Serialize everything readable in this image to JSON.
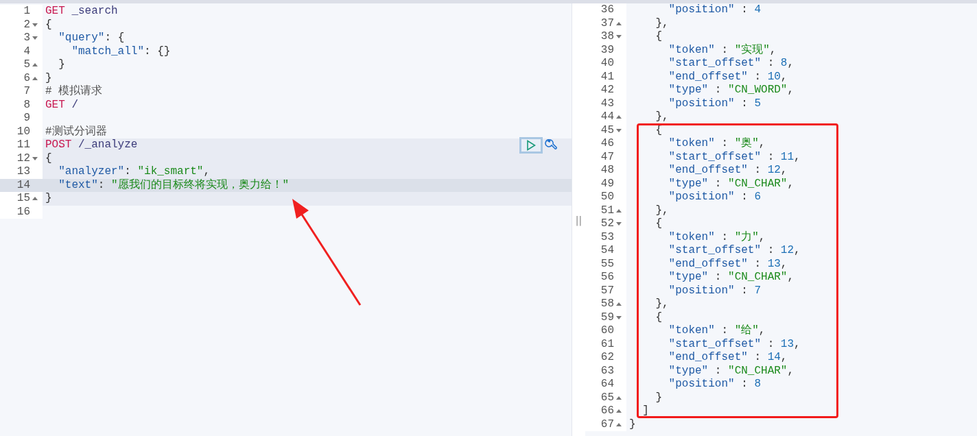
{
  "request_editor": {
    "lines": [
      {
        "number": "1",
        "in_request": false,
        "current": false,
        "tokens": [
          {
            "kind": "method",
            "text": "GET"
          },
          {
            "kind": "path",
            "text": " _search"
          }
        ]
      },
      {
        "number": "2",
        "expanded": true,
        "in_request": false,
        "current": false,
        "tokens": [
          {
            "kind": "punct",
            "text": "{"
          }
        ]
      },
      {
        "number": "3",
        "expanded": true,
        "in_request": false,
        "current": false,
        "tokens": [
          {
            "kind": "key",
            "text": "  \"query\""
          },
          {
            "kind": "punct",
            "text": ": {"
          }
        ]
      },
      {
        "number": "4",
        "in_request": false,
        "current": false,
        "tokens": [
          {
            "kind": "key",
            "text": "    \"match_all\""
          },
          {
            "kind": "punct",
            "text": ": {}"
          }
        ]
      },
      {
        "number": "5",
        "expanded": false,
        "in_request": false,
        "current": false,
        "tokens": [
          {
            "kind": "punct",
            "text": "  }"
          }
        ]
      },
      {
        "number": "6",
        "expanded": false,
        "in_request": false,
        "current": false,
        "tokens": [
          {
            "kind": "punct",
            "text": "}"
          }
        ]
      },
      {
        "number": "7",
        "in_request": false,
        "current": false,
        "tokens": [
          {
            "kind": "comment",
            "text": "# 模拟请求"
          }
        ]
      },
      {
        "number": "8",
        "in_request": false,
        "current": false,
        "tokens": [
          {
            "kind": "method",
            "text": "GET"
          },
          {
            "kind": "path",
            "text": " /"
          }
        ]
      },
      {
        "number": "9",
        "in_request": false,
        "current": false
      },
      {
        "number": "10",
        "in_request": false,
        "current": false,
        "tokens": [
          {
            "kind": "comment",
            "text": "#测试分词器"
          }
        ]
      },
      {
        "number": "11",
        "in_request": true,
        "current": false,
        "actions": true,
        "tokens": [
          {
            "kind": "method",
            "text": "POST"
          },
          {
            "kind": "path",
            "text": " /_analyze"
          }
        ]
      },
      {
        "number": "12",
        "expanded": true,
        "in_request": true,
        "current": false,
        "tokens": [
          {
            "kind": "punct",
            "text": "{"
          }
        ]
      },
      {
        "number": "13",
        "in_request": true,
        "current": false,
        "tokens": [
          {
            "kind": "key",
            "text": "  \"analyzer\""
          },
          {
            "kind": "punct",
            "text": ": "
          },
          {
            "kind": "string",
            "text": "\"ik_smart\""
          },
          {
            "kind": "punct",
            "text": ","
          }
        ]
      },
      {
        "number": "14",
        "in_request": true,
        "current": true,
        "tokens": [
          {
            "kind": "key",
            "text": "  \"text\""
          },
          {
            "kind": "punct",
            "text": ": "
          },
          {
            "kind": "string",
            "text": "\"愿我们的目标终将实现，奥力给！\""
          }
        ]
      },
      {
        "number": "15",
        "expanded": false,
        "in_request": true,
        "current": false,
        "tokens": [
          {
            "kind": "punct",
            "text": "}"
          }
        ]
      },
      {
        "number": "16",
        "in_request": false,
        "current": false
      }
    ]
  },
  "response_viewer": {
    "lines": [
      {
        "number": "36",
        "tokens": [
          {
            "kind": "key",
            "text": "      \"position\""
          },
          {
            "kind": "punct",
            "text": " : "
          },
          {
            "kind": "number",
            "text": "4"
          }
        ]
      },
      {
        "number": "37",
        "expanded": false,
        "tokens": [
          {
            "kind": "punct",
            "text": "    },"
          }
        ]
      },
      {
        "number": "38",
        "expanded": true,
        "tokens": [
          {
            "kind": "punct",
            "text": "    {"
          }
        ]
      },
      {
        "number": "39",
        "tokens": [
          {
            "kind": "key",
            "text": "      \"token\""
          },
          {
            "kind": "punct",
            "text": " : "
          },
          {
            "kind": "string",
            "text": "\"实现\""
          },
          {
            "kind": "punct",
            "text": ","
          }
        ]
      },
      {
        "number": "40",
        "tokens": [
          {
            "kind": "key",
            "text": "      \"start_offset\""
          },
          {
            "kind": "punct",
            "text": " : "
          },
          {
            "kind": "number",
            "text": "8"
          },
          {
            "kind": "punct",
            "text": ","
          }
        ]
      },
      {
        "number": "41",
        "tokens": [
          {
            "kind": "key",
            "text": "      \"end_offset\""
          },
          {
            "kind": "punct",
            "text": " : "
          },
          {
            "kind": "number",
            "text": "10"
          },
          {
            "kind": "punct",
            "text": ","
          }
        ]
      },
      {
        "number": "42",
        "tokens": [
          {
            "kind": "key",
            "text": "      \"type\""
          },
          {
            "kind": "punct",
            "text": " : "
          },
          {
            "kind": "string",
            "text": "\"CN_WORD\""
          },
          {
            "kind": "punct",
            "text": ","
          }
        ]
      },
      {
        "number": "43",
        "tokens": [
          {
            "kind": "key",
            "text": "      \"position\""
          },
          {
            "kind": "punct",
            "text": " : "
          },
          {
            "kind": "number",
            "text": "5"
          }
        ]
      },
      {
        "number": "44",
        "expanded": false,
        "tokens": [
          {
            "kind": "punct",
            "text": "    },"
          }
        ]
      },
      {
        "number": "45",
        "expanded": true,
        "tokens": [
          {
            "kind": "punct",
            "text": "    {"
          }
        ]
      },
      {
        "number": "46",
        "tokens": [
          {
            "kind": "key",
            "text": "      \"token\""
          },
          {
            "kind": "punct",
            "text": " : "
          },
          {
            "kind": "string",
            "text": "\"奥\""
          },
          {
            "kind": "punct",
            "text": ","
          }
        ]
      },
      {
        "number": "47",
        "tokens": [
          {
            "kind": "key",
            "text": "      \"start_offset\""
          },
          {
            "kind": "punct",
            "text": " : "
          },
          {
            "kind": "number",
            "text": "11"
          },
          {
            "kind": "punct",
            "text": ","
          }
        ]
      },
      {
        "number": "48",
        "tokens": [
          {
            "kind": "key",
            "text": "      \"end_offset\""
          },
          {
            "kind": "punct",
            "text": " : "
          },
          {
            "kind": "number",
            "text": "12"
          },
          {
            "kind": "punct",
            "text": ","
          }
        ]
      },
      {
        "number": "49",
        "tokens": [
          {
            "kind": "key",
            "text": "      \"type\""
          },
          {
            "kind": "punct",
            "text": " : "
          },
          {
            "kind": "string",
            "text": "\"CN_CHAR\""
          },
          {
            "kind": "punct",
            "text": ","
          }
        ]
      },
      {
        "number": "50",
        "tokens": [
          {
            "kind": "key",
            "text": "      \"position\""
          },
          {
            "kind": "punct",
            "text": " : "
          },
          {
            "kind": "number",
            "text": "6"
          }
        ]
      },
      {
        "number": "51",
        "expanded": false,
        "tokens": [
          {
            "kind": "punct",
            "text": "    },"
          }
        ]
      },
      {
        "number": "52",
        "expanded": true,
        "tokens": [
          {
            "kind": "punct",
            "text": "    {"
          }
        ]
      },
      {
        "number": "53",
        "tokens": [
          {
            "kind": "key",
            "text": "      \"token\""
          },
          {
            "kind": "punct",
            "text": " : "
          },
          {
            "kind": "string",
            "text": "\"力\""
          },
          {
            "kind": "punct",
            "text": ","
          }
        ]
      },
      {
        "number": "54",
        "tokens": [
          {
            "kind": "key",
            "text": "      \"start_offset\""
          },
          {
            "kind": "punct",
            "text": " : "
          },
          {
            "kind": "number",
            "text": "12"
          },
          {
            "kind": "punct",
            "text": ","
          }
        ]
      },
      {
        "number": "55",
        "tokens": [
          {
            "kind": "key",
            "text": "      \"end_offset\""
          },
          {
            "kind": "punct",
            "text": " : "
          },
          {
            "kind": "number",
            "text": "13"
          },
          {
            "kind": "punct",
            "text": ","
          }
        ]
      },
      {
        "number": "56",
        "tokens": [
          {
            "kind": "key",
            "text": "      \"type\""
          },
          {
            "kind": "punct",
            "text": " : "
          },
          {
            "kind": "string",
            "text": "\"CN_CHAR\""
          },
          {
            "kind": "punct",
            "text": ","
          }
        ]
      },
      {
        "number": "57",
        "tokens": [
          {
            "kind": "key",
            "text": "      \"position\""
          },
          {
            "kind": "punct",
            "text": " : "
          },
          {
            "kind": "number",
            "text": "7"
          }
        ]
      },
      {
        "number": "58",
        "expanded": false,
        "tokens": [
          {
            "kind": "punct",
            "text": "    },"
          }
        ]
      },
      {
        "number": "59",
        "expanded": true,
        "tokens": [
          {
            "kind": "punct",
            "text": "    {"
          }
        ]
      },
      {
        "number": "60",
        "tokens": [
          {
            "kind": "key",
            "text": "      \"token\""
          },
          {
            "kind": "punct",
            "text": " : "
          },
          {
            "kind": "string",
            "text": "\"给\""
          },
          {
            "kind": "punct",
            "text": ","
          }
        ]
      },
      {
        "number": "61",
        "tokens": [
          {
            "kind": "key",
            "text": "      \"start_offset\""
          },
          {
            "kind": "punct",
            "text": " : "
          },
          {
            "kind": "number",
            "text": "13"
          },
          {
            "kind": "punct",
            "text": ","
          }
        ]
      },
      {
        "number": "62",
        "tokens": [
          {
            "kind": "key",
            "text": "      \"end_offset\""
          },
          {
            "kind": "punct",
            "text": " : "
          },
          {
            "kind": "number",
            "text": "14"
          },
          {
            "kind": "punct",
            "text": ","
          }
        ]
      },
      {
        "number": "63",
        "tokens": [
          {
            "kind": "key",
            "text": "      \"type\""
          },
          {
            "kind": "punct",
            "text": " : "
          },
          {
            "kind": "string",
            "text": "\"CN_CHAR\""
          },
          {
            "kind": "punct",
            "text": ","
          }
        ]
      },
      {
        "number": "64",
        "tokens": [
          {
            "kind": "key",
            "text": "      \"position\""
          },
          {
            "kind": "punct",
            "text": " : "
          },
          {
            "kind": "number",
            "text": "8"
          }
        ]
      },
      {
        "number": "65",
        "expanded": false,
        "tokens": [
          {
            "kind": "punct",
            "text": "    }"
          }
        ]
      },
      {
        "number": "66",
        "expanded": false,
        "tokens": [
          {
            "kind": "punct",
            "text": "  ]"
          }
        ]
      },
      {
        "number": "67",
        "expanded": false,
        "tokens": [
          {
            "kind": "punct",
            "text": "}"
          }
        ]
      }
    ]
  },
  "divider": {
    "handle": "||"
  }
}
